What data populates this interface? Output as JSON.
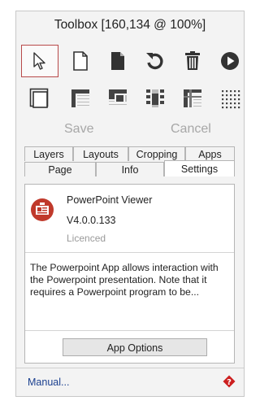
{
  "window": {
    "title": "Toolbox [160,134 @ 100%]"
  },
  "toolbar_row1": [
    {
      "icon": "pointer-icon"
    },
    {
      "icon": "blank-page-icon"
    },
    {
      "icon": "filled-page-icon"
    },
    {
      "icon": "rotate-icon"
    },
    {
      "icon": "trash-icon"
    },
    {
      "icon": "play-icon"
    }
  ],
  "toolbar_row2": [
    {
      "icon": "page-frame-icon"
    },
    {
      "icon": "layout-top-left-icon"
    },
    {
      "icon": "layout-stepped-icon"
    },
    {
      "icon": "layout-center-icon"
    },
    {
      "icon": "layout-cross-icon"
    },
    {
      "icon": "dotted-grid-icon"
    }
  ],
  "actions": {
    "save": "Save",
    "cancel": "Cancel"
  },
  "tabs_row1": [
    "Layers",
    "Layouts",
    "Cropping",
    "Apps"
  ],
  "tabs_row2": [
    "Page",
    "Info",
    "Settings"
  ],
  "active_tab": "Settings",
  "app": {
    "name": "PowerPoint Viewer",
    "version": "V4.0.0.133",
    "license": "Licenced",
    "description": "The Powerpoint App allows interaction with the Powerpoint presentation. Note that it requires a Powerpoint program to be...",
    "options_label": "App Options",
    "accent_color": "#c0392b"
  },
  "footer": {
    "manual_label": "Manual...",
    "help_icon_color": "#cc1f1f"
  }
}
